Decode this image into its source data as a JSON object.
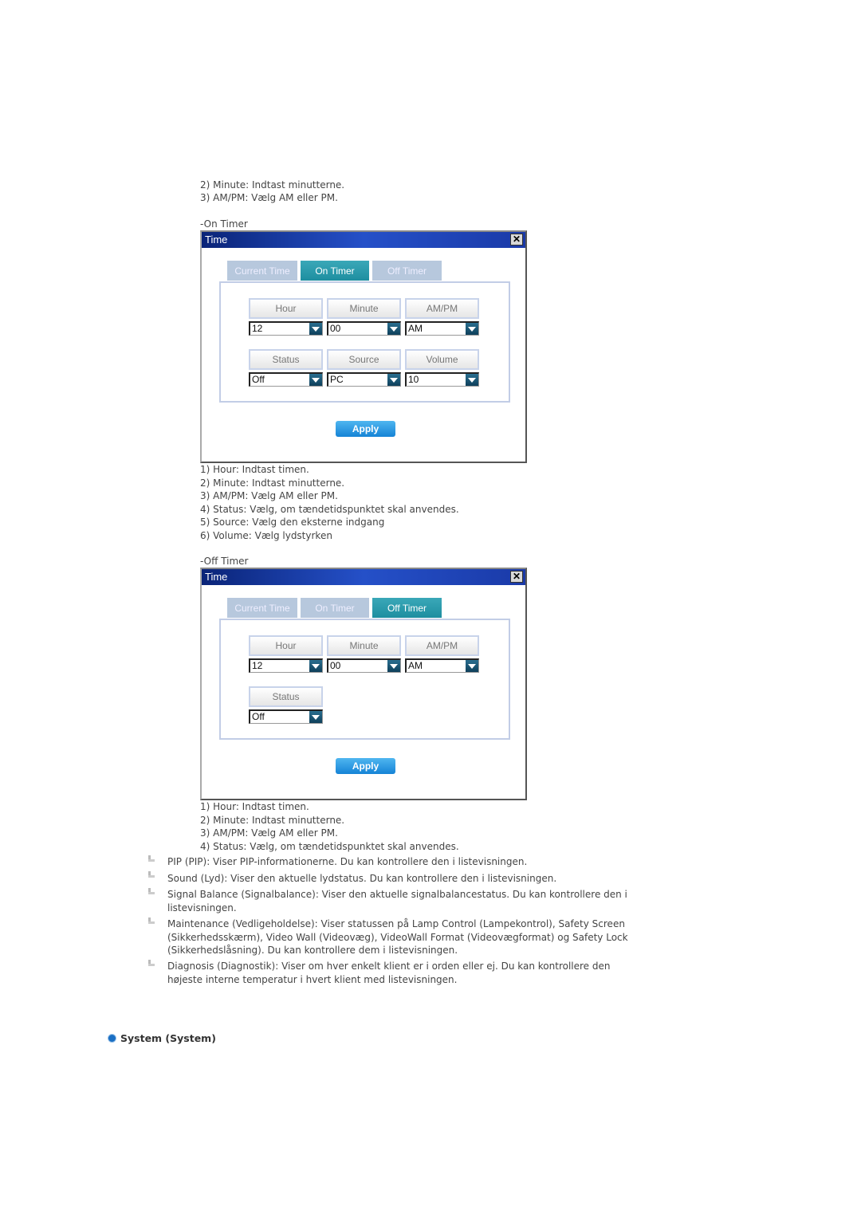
{
  "intro_lines": [
    "2) Minute: Indtast minutterne.",
    "3) AM/PM: Vælg AM eller PM."
  ],
  "on_timer": {
    "heading": "-On Timer",
    "dialog": {
      "title": "Time",
      "tabs": [
        "Current Time",
        "On Timer",
        "Off Timer"
      ],
      "active_tab": "On Timer",
      "fields": [
        {
          "label": "Hour",
          "value": "12"
        },
        {
          "label": "Minute",
          "value": "00"
        },
        {
          "label": "AM/PM",
          "value": "AM"
        },
        {
          "label": "Status",
          "value": "Off"
        },
        {
          "label": "Source",
          "value": "PC"
        },
        {
          "label": "Volume",
          "value": "10"
        }
      ],
      "apply": "Apply"
    },
    "notes": [
      "1) Hour: Indtast timen.",
      "2) Minute: Indtast minutterne.",
      "3) AM/PM: Vælg AM eller PM.",
      "4) Status: Vælg, om tændetidspunktet skal anvendes.",
      "5) Source: Vælg den eksterne indgang",
      "6) Volume: Vælg lydstyrken"
    ]
  },
  "off_timer": {
    "heading": "-Off Timer",
    "dialog": {
      "title": "Time",
      "tabs": [
        "Current Time",
        "On Timer",
        "Off Timer"
      ],
      "active_tab": "Off Timer",
      "fields": [
        {
          "label": "Hour",
          "value": "12"
        },
        {
          "label": "Minute",
          "value": "00"
        },
        {
          "label": "AM/PM",
          "value": "AM"
        },
        {
          "label": "Status",
          "value": "Off"
        }
      ],
      "apply": "Apply"
    },
    "notes": [
      "1) Hour: Indtast timen.",
      "2) Minute: Indtast minutterne.",
      "3) AM/PM: Vælg AM eller PM.",
      "4) Status: Vælg, om tændetidspunktet skal anvendes."
    ]
  },
  "bullets": [
    "PIP (PIP): Viser PIP-informationerne. Du kan kontrollere den i listevisningen.",
    "Sound (Lyd): Viser den aktuelle lydstatus. Du kan kontrollere den i listevisningen.",
    "Signal Balance (Signalbalance): Viser den aktuelle signalbalancestatus. Du kan kontrollere den i listevisningen.",
    "Maintenance (Vedligeholdelse): Viser statussen på Lamp Control (Lampekontrol), Safety Screen (Sikkerhedsskærm), Video Wall (Videovæg), VideoWall Format (Videovægformat) og Safety Lock (Sikkerhedslåsning). Du kan kontrollere dem i listevisningen.",
    "Diagnosis (Diagnostik): Viser om hver enkelt klient er i orden eller ej. Du kan kontrollere den højeste interne temperatur i hvert klient med listevisningen."
  ],
  "section": {
    "title": "System (System)",
    "bullet_color": "#1a6fc4"
  }
}
